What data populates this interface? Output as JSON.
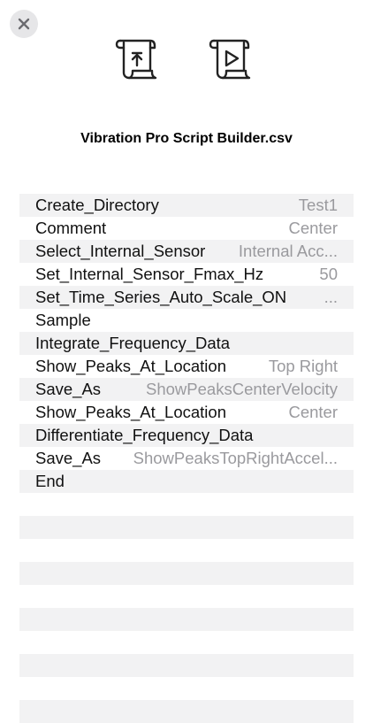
{
  "header": {
    "close_icon": "close-icon",
    "export_icon": "scroll-upload-icon",
    "run_icon": "scroll-play-icon"
  },
  "file": {
    "title": "Vibration Pro Script Builder.csv"
  },
  "script": {
    "rows": [
      {
        "command": "Create_Directory",
        "value": "Test1"
      },
      {
        "command": "Comment",
        "value": "Center"
      },
      {
        "command": "Select_Internal_Sensor",
        "value": "Internal Acc..."
      },
      {
        "command": "Set_Internal_Sensor_Fmax_Hz",
        "value": "50"
      },
      {
        "command": "Set_Time_Series_Auto_Scale_ON",
        "value": "..."
      },
      {
        "command": "Sample",
        "value": ""
      },
      {
        "command": "Integrate_Frequency_Data",
        "value": ""
      },
      {
        "command": "Show_Peaks_At_Location",
        "value": "Top Right"
      },
      {
        "command": "Save_As",
        "value": "ShowPeaksCenterVelocity"
      },
      {
        "command": "Show_Peaks_At_Location",
        "value": "Center"
      },
      {
        "command": "Differentiate_Frequency_Data",
        "value": ""
      },
      {
        "command": "Save_As",
        "value": "ShowPeaksTopRightAccel..."
      },
      {
        "command": "End",
        "value": ""
      }
    ]
  },
  "colors": {
    "row_alt": "#f2f2f3",
    "value_text": "#9a9a9e",
    "close_bg": "#e6e6e8"
  }
}
